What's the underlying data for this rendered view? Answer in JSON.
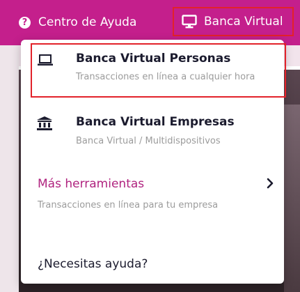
{
  "topbar": {
    "help_label": "Centro de Ayuda",
    "banca_label": "Banca Virtual",
    "help_icon": "question-circle-icon",
    "banca_icon": "monitor-icon"
  },
  "menu": {
    "items": [
      {
        "title": "Banca Virtual Personas",
        "description": "Transacciones en línea a cualquier hora",
        "icon": "laptop-icon"
      },
      {
        "title": "Banca Virtual Empresas",
        "description": "Banca Virtual / Multidispositivos",
        "icon": "bank-icon"
      }
    ],
    "tools": {
      "title": "Más herramientas",
      "description": "Transacciones en línea para tu empresa",
      "icon": "chevron-right-icon"
    },
    "help_question": "¿Necesitas ayuda?"
  },
  "colors": {
    "brand_magenta": "#c41f8c",
    "highlight_red": "#e2222a",
    "tools_pink": "#b0237f"
  }
}
